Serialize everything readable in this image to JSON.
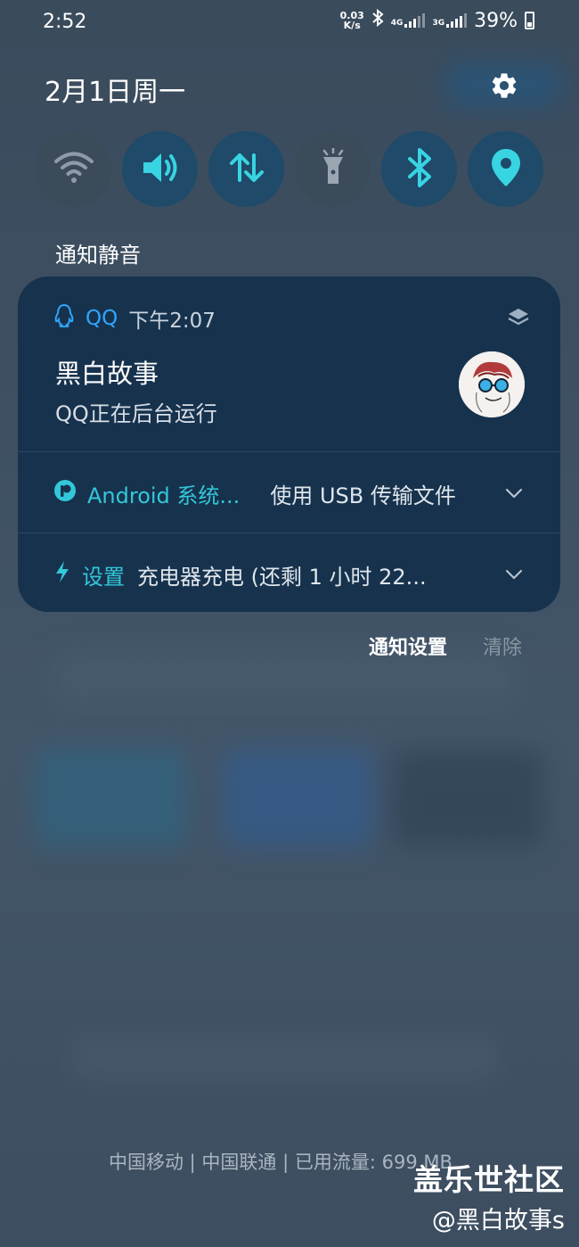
{
  "status_bar": {
    "time": "2:52",
    "net_speed_value": "0.03",
    "net_speed_unit": "K/s",
    "sim1_tag": "4G",
    "sim2_tag": "3G",
    "battery": "39%"
  },
  "header": {
    "date": "2月1日周一"
  },
  "quick_settings": [
    {
      "name": "wifi",
      "icon": "wifi-icon",
      "state": "off"
    },
    {
      "name": "sound",
      "icon": "volume-icon",
      "state": "on"
    },
    {
      "name": "mobile-data",
      "icon": "data-transfer-icon",
      "state": "on"
    },
    {
      "name": "flashlight",
      "icon": "flashlight-icon",
      "state": "off"
    },
    {
      "name": "bluetooth",
      "icon": "bluetooth-icon",
      "state": "on"
    },
    {
      "name": "location",
      "icon": "location-icon",
      "state": "on"
    }
  ],
  "section": {
    "mute_label": "通知静音"
  },
  "notifications": {
    "qq": {
      "app": "QQ",
      "time": "下午2:07",
      "title": "黑白故事",
      "body": "QQ正在后台运行"
    },
    "android": {
      "app": "Android 系统...",
      "message": "使用 USB 传输文件"
    },
    "settings": {
      "app": "设置",
      "message": "充电器充电 (还剩 1 小时 22..."
    }
  },
  "actions": {
    "settings_label": "通知设置",
    "clear_label": "清除"
  },
  "footer": {
    "carrier": "中国移动 | 中国联通 | 已用流量: 699 MB"
  },
  "watermark": {
    "line1": "盖乐世社区",
    "line2": "@黑白故事s"
  },
  "colors": {
    "accent_cyan": "#33c7d9",
    "qq_blue": "#2fa7ff",
    "card_bg": "#17324d"
  }
}
